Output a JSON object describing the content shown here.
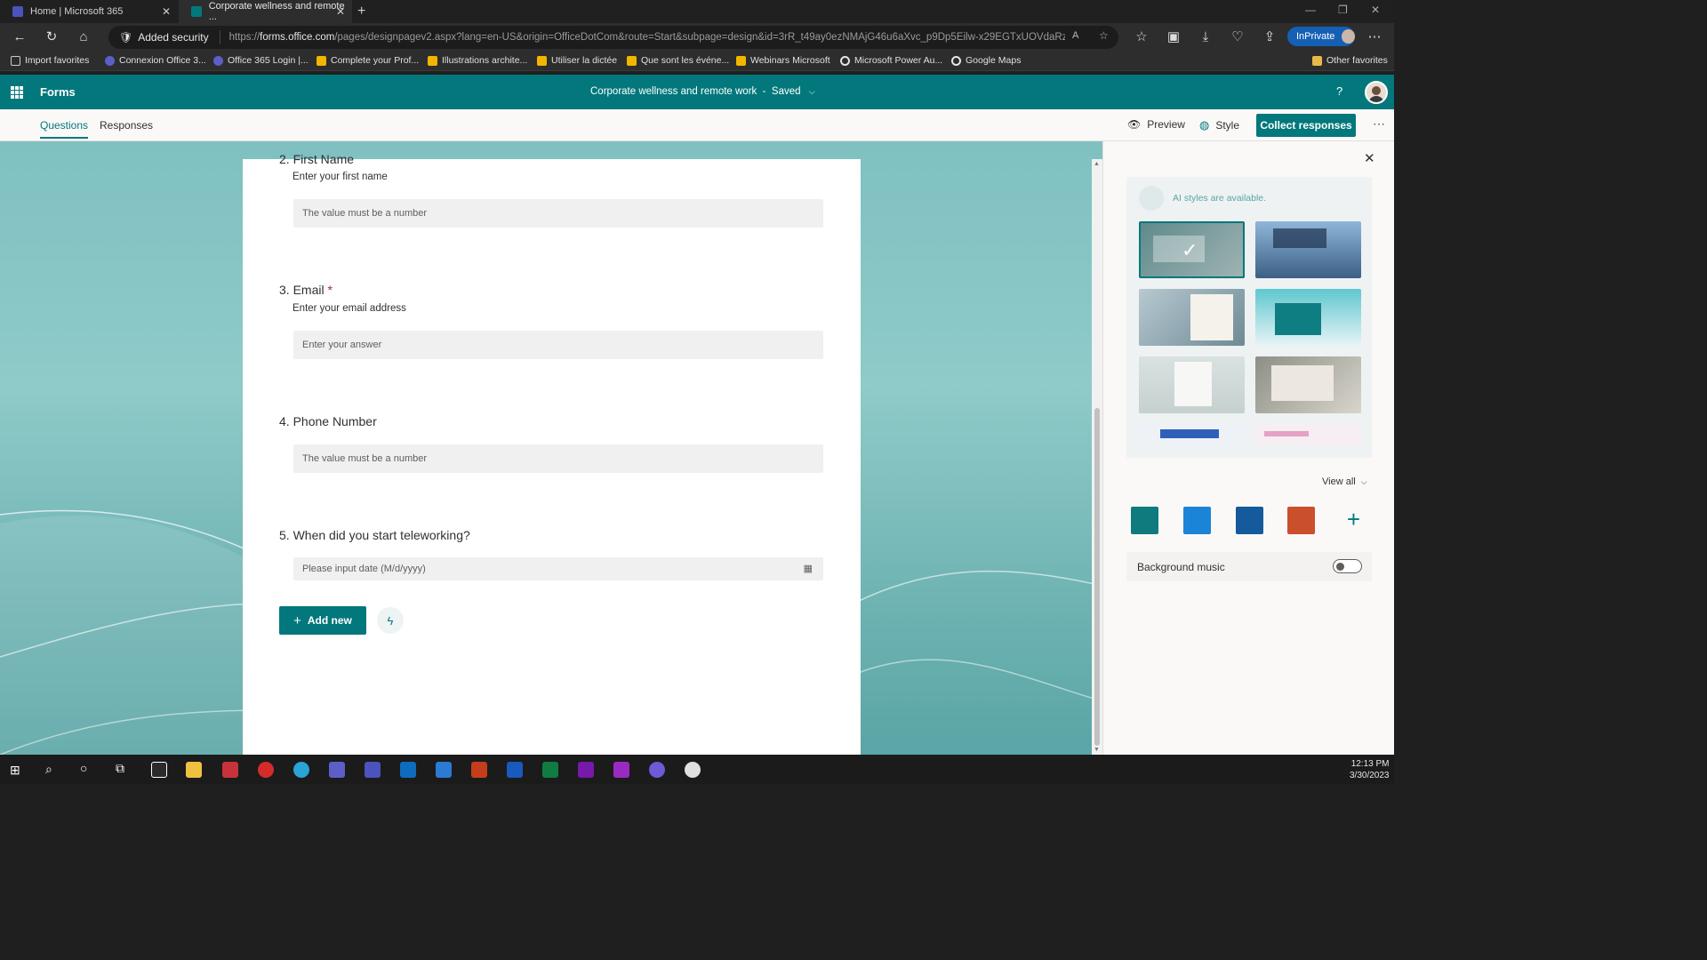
{
  "browser": {
    "tabs": [
      {
        "label": "Home | Microsoft 365"
      },
      {
        "label": "Corporate wellness and remote ..."
      }
    ],
    "security_label": "Added security",
    "url_prefix": "https://",
    "url_host": "forms.office.com",
    "url_path": "/pages/designpagev2.aspx?lang=en-US&origin=OfficeDotCom&route=Start&subpage=design&id=3rR_t49ay0ezNMAjG46u6aXvc_p9Dp5Eilw-x29EGTxUOVdaRzE...",
    "inprivate_label": "InPrivate",
    "favorites": [
      {
        "label": "Import favorites",
        "color": "#cfcfcf"
      },
      {
        "label": "Connexion Office 3...",
        "color": "#5b5fc7"
      },
      {
        "label": "Office 365 Login |...",
        "color": "#5b5fc7"
      },
      {
        "label": "Complete your Prof...",
        "color": "#f2b600"
      },
      {
        "label": "Illustrations archite...",
        "color": "#f2b600"
      },
      {
        "label": "Utiliser la dictée",
        "color": "#f2b600"
      },
      {
        "label": "Que sont les événe...",
        "color": "#f2b600"
      },
      {
        "label": "Webinars Microsoft",
        "color": "#f2b600"
      },
      {
        "label": "Microsoft Power Au...",
        "color": "#e6e6e6"
      },
      {
        "label": "Google Maps",
        "color": "#e6e6e6"
      }
    ],
    "other_favorites": "Other favorites"
  },
  "app": {
    "name": "Forms",
    "doc_title": "Corporate wellness and remote work",
    "separator": "-",
    "saved": "Saved"
  },
  "commandbar": {
    "tabs": [
      "Questions",
      "Responses"
    ],
    "preview": "Preview",
    "style": "Style",
    "collect": "Collect responses"
  },
  "form": {
    "q2_title": "2. First Name",
    "q2_subtitle": "Enter your first name",
    "q2_placeholder": "The value must be a number",
    "q3_title": "3. Email",
    "q3_required": "*",
    "q3_subtitle": "Enter your email address",
    "q3_placeholder": "Enter your answer",
    "q4_title": "4. Phone Number",
    "q4_placeholder": "The value must be a number",
    "q5_title": "5. When did you start teleworking?",
    "q5_placeholder": "Please input date (M/d/yyyy)",
    "add_new": "Add new"
  },
  "style_panel": {
    "ai_text": "AI styles are available.",
    "view_all": "View all",
    "theme_colors": [
      "#0f7b7e",
      "#1b84d6",
      "#155a9c",
      "#c94f2d"
    ],
    "background_music": "Background music",
    "background_music_on": false
  },
  "taskbar": {
    "time": "12:13 PM",
    "date": "3/30/2023"
  }
}
